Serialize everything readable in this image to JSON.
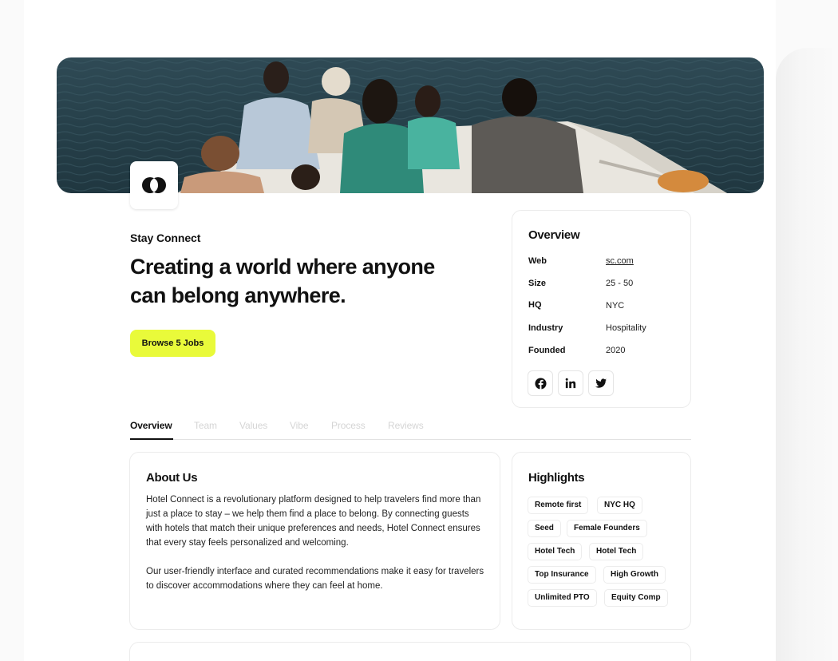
{
  "company": {
    "name": "Stay Connect",
    "headline": "Creating a world where anyone can belong anywhere.",
    "cta_label": "Browse 5 Jobs"
  },
  "overview": {
    "title": "Overview",
    "rows": [
      {
        "key": "Web",
        "value": "sc.com"
      },
      {
        "key": "Size",
        "value": "25 - 50"
      },
      {
        "key": "HQ",
        "value": "NYC"
      },
      {
        "key": "Industry",
        "value": "Hospitality"
      },
      {
        "key": "Founded",
        "value": "2020"
      }
    ],
    "social": [
      "facebook-icon",
      "linkedin-icon",
      "twitter-icon"
    ]
  },
  "tabs": [
    "Overview",
    "Team",
    "Values",
    "Vibe",
    "Process",
    "Reviews"
  ],
  "about": {
    "title": "About Us",
    "paragraphs": [
      "Hotel Connect is a revolutionary platform designed to help travelers find more than just a place to stay – we help them find a place to belong. By connecting guests with hotels that match their unique preferences and needs, Hotel Connect ensures that every stay feels personalized and welcoming.",
      "Our user-friendly interface and curated recommendations make it easy for travelers to discover accommodations where they can feel at home."
    ]
  },
  "highlights": {
    "title": "Highlights",
    "chips": [
      [
        "Remote first",
        "NYC HQ"
      ],
      [
        "Seed",
        "Female Founders"
      ],
      [
        "Hotel Tech",
        "Hotel Tech"
      ],
      [
        "Top Insurance",
        "High Growth"
      ],
      [
        "Unlimited PTO",
        "Equity Comp"
      ]
    ]
  },
  "colors": {
    "accent": "#e9fa3a",
    "text": "#111111",
    "muted_tab": "#d5d5d5"
  }
}
